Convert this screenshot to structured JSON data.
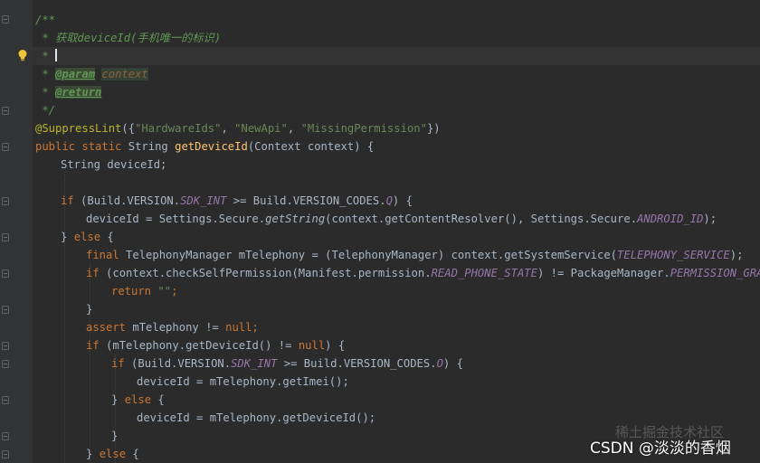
{
  "editor": {
    "theme_colors": {
      "background": "#2b2b2b",
      "gutter": "#313335",
      "keyword": "#cc7832",
      "function": "#ffc66d",
      "string": "#6a8759",
      "doc_comment": "#629755",
      "annotation": "#bbb529",
      "static_field": "#9876aa",
      "plain": "#a9b7c6"
    },
    "gutter_icons": [
      "fold-marker-icon",
      "lightbulb-icon"
    ]
  },
  "code": {
    "doc_open": "/**",
    "doc_summary_prefix": " * ",
    "doc_summary": "获取deviceId(手机唯一的标识)",
    "doc_star": " * ",
    "doc_param_prefix": " * ",
    "doc_param_tag": "@param",
    "doc_param_name": "context",
    "doc_return_prefix": " * ",
    "doc_return_tag": "@return",
    "doc_close": " */",
    "annotation": "@SuppressLint",
    "annotation_open": "({",
    "ann_arg1": "\"HardwareIds\"",
    "ann_sep1": ", ",
    "ann_arg2": "\"NewApi\"",
    "ann_sep2": ", ",
    "ann_arg3": "\"MissingPermission\"",
    "annotation_close": "})",
    "sig_modifiers": "public static ",
    "sig_type": "String ",
    "sig_name": "getDeviceId",
    "sig_params": "(Context context) {",
    "l9": "String deviceId;",
    "l11_kw": "if ",
    "l11_a": "(Build.VERSION.",
    "l11_sf": "SDK_INT",
    "l11_b": " >= Build.VERSION_CODES.",
    "l11_sf2": "Q",
    "l11_c": ") {",
    "l12_a": "deviceId = Settings.Secure.",
    "l12_fn": "getString",
    "l12_b": "(context.getContentResolver(), Settings.Secure.",
    "l12_sf": "ANDROID_ID",
    "l12_c": ");",
    "l13_a": "} ",
    "l13_kw": "else",
    "l13_b": " {",
    "l14_kw": "final ",
    "l14_a": "TelephonyManager mTelephony = (TelephonyManager) context.getSystemService(",
    "l14_sf": "TELEPHONY_SERVICE",
    "l14_b": ");",
    "l15_kw": "if ",
    "l15_a": "(context.checkSelfPermission(Manifest.permission.",
    "l15_sf": "READ_PHONE_STATE",
    "l15_b": ") != PackageManager.",
    "l15_sf2": "PERMISSION_GRANTED",
    "l15_c": ")",
    "l16_kw": "return ",
    "l16_str": "\"\"",
    "l16_a": ";",
    "l17": "}",
    "l18_kw": "assert ",
    "l18_a": "mTelephony != ",
    "l18_kw2": "null",
    "l18_b": ";",
    "l19_kw": "if ",
    "l19_a": "(mTelephony.getDeviceId() != ",
    "l19_kw2": "null",
    "l19_b": ") {",
    "l20_kw": "if ",
    "l20_a": "(Build.VERSION.",
    "l20_sf": "SDK_INT",
    "l20_b": " >= Build.VERSION_CODES.",
    "l20_sf2": "O",
    "l20_c": ") {",
    "l21": "deviceId = mTelephony.getImei();",
    "l22_a": "} ",
    "l22_kw": "else",
    "l22_b": " {",
    "l23": "deviceId = mTelephony.getDeviceId();",
    "l24": "}",
    "l25_a": "} ",
    "l25_kw": "else",
    "l25_b": " {"
  },
  "watermark": {
    "faint": "稀土掘金技术社区",
    "main": "CSDN @淡淡的香烟"
  }
}
